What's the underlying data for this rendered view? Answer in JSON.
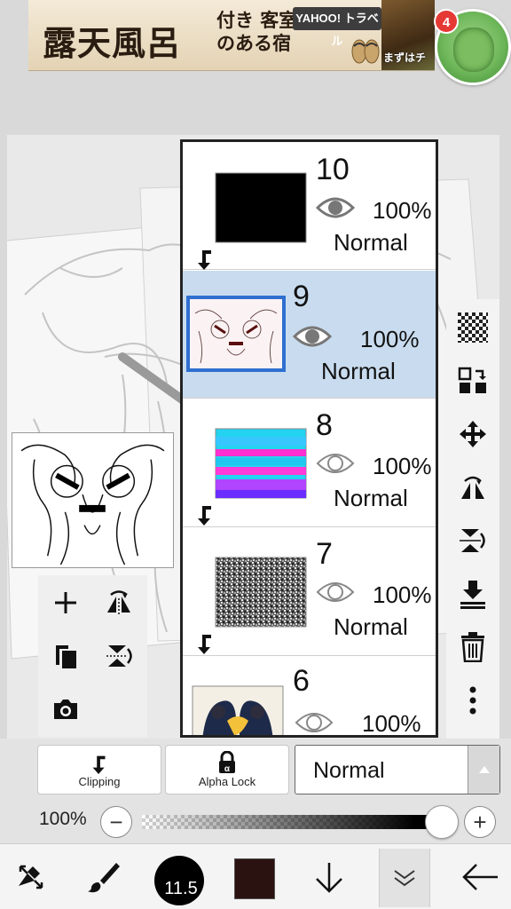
{
  "ad": {
    "headline": "露天風呂",
    "sub": "付き 客室のある宿",
    "brand": "YAHOO! トラベル",
    "cta": "まずはチ"
  },
  "notification_badge": "4",
  "layers": [
    {
      "number": "10",
      "opacity": "100%",
      "blend": "Normal",
      "clipped": true,
      "selected": false,
      "thumb": "black"
    },
    {
      "number": "9",
      "opacity": "100%",
      "blend": "Normal",
      "clipped": false,
      "selected": true,
      "thumb": "sketch"
    },
    {
      "number": "8",
      "opacity": "100%",
      "blend": "Normal",
      "clipped": true,
      "selected": false,
      "thumb": "stripes"
    },
    {
      "number": "7",
      "opacity": "100%",
      "blend": "Normal",
      "clipped": true,
      "selected": false,
      "thumb": "noise"
    },
    {
      "number": "6",
      "opacity": "100%",
      "blend": "",
      "clipped": false,
      "selected": false,
      "thumb": "character"
    }
  ],
  "controls": {
    "clipping_label": "Clipping",
    "alpha_lock_label": "Alpha Lock",
    "blend_mode": "Normal"
  },
  "opacity": {
    "label": "100%",
    "value": 1.0,
    "minus": "−",
    "plus": "+"
  },
  "brush": {
    "size": "11.5",
    "color": "#2a1210"
  },
  "colors": {
    "selection_blue": "#2f6fd0",
    "selected_row": "#c9dcef",
    "badge_red": "#e53935"
  }
}
